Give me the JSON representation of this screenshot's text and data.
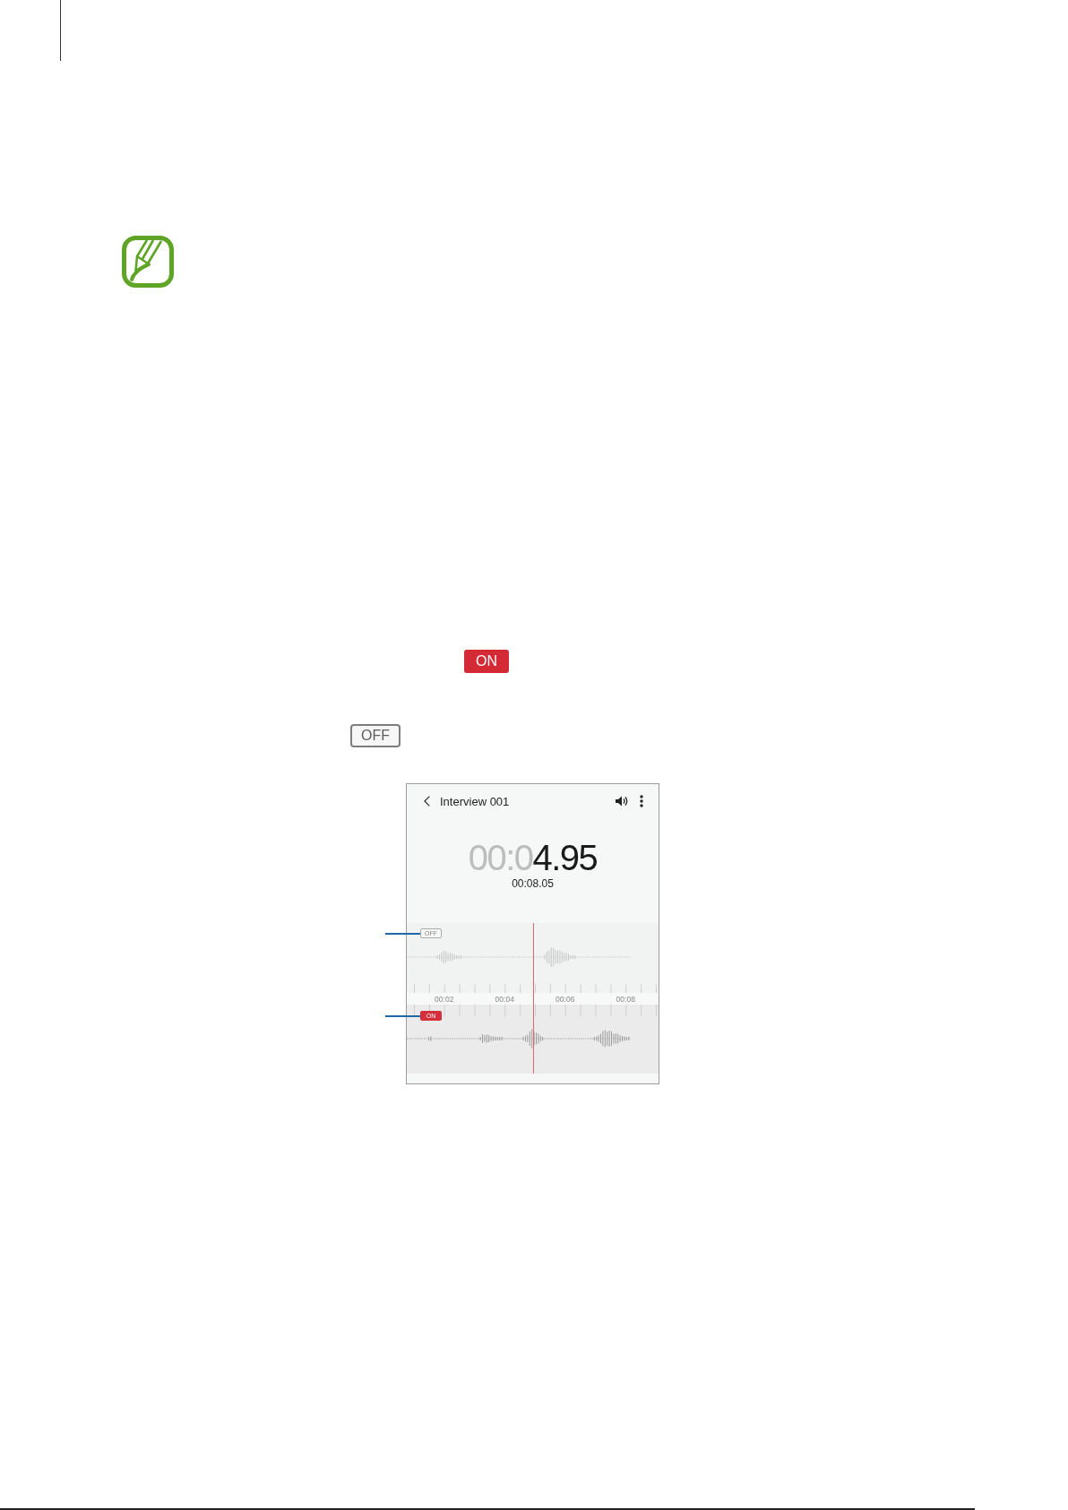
{
  "inline_buttons": [
    {
      "label": "ON",
      "on": true
    },
    {
      "label": "OFF",
      "on": false
    }
  ],
  "screenshot": {
    "title": "Interview 001",
    "elapsed": {
      "leading": "00:0",
      "rest": "4.95"
    },
    "duration": "00:08.05",
    "tracks": [
      {
        "label": "OFF",
        "on": false
      },
      {
        "label": "ON",
        "on": true
      }
    ],
    "time_labels": [
      "00:02",
      "00:04",
      "00:06",
      "00:08"
    ]
  }
}
